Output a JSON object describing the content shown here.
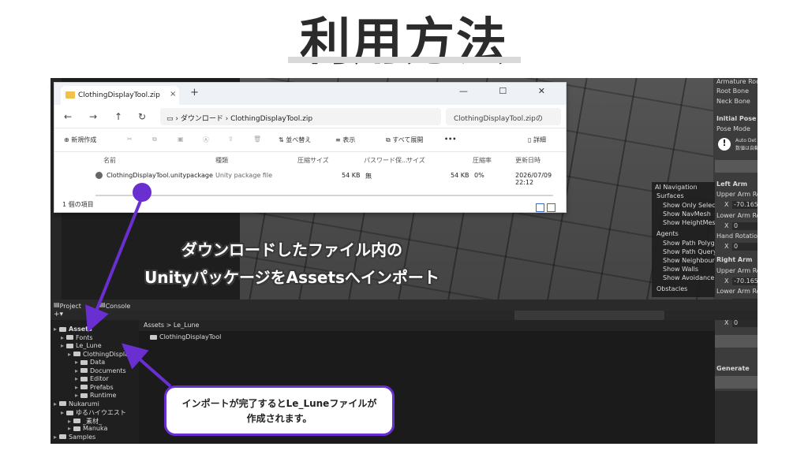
{
  "title": "利用方法",
  "explorer": {
    "tab_title": "ClothingDisplayTool.zip",
    "tab_close": "×",
    "new_tab": "+",
    "window_controls": "— ☐ ✕",
    "nav_back": "←",
    "nav_forward": "→",
    "nav_up": "↑",
    "nav_refresh": "↻",
    "address_path": "▭  ›  ダウンロード  ›  ClothingDisplayTool.zip",
    "search_placeholder": "ClothingDisplayTool.zipの",
    "toolbar": {
      "new": "⊕ 新規作成",
      "sort": "⇅ 並べ替え",
      "view": "≡ 表示",
      "extract_all": "すべて展開",
      "more": "•••",
      "details": "詳細"
    },
    "columns": [
      "名前",
      "種類",
      "圧縮サイズ",
      "パスワード保...",
      "サイズ",
      "圧縮率",
      "更新日時"
    ],
    "row": {
      "name": "ClothingDisplayTool.unitypackage",
      "type": "Unity package file",
      "compressed_size": "54 KB",
      "password": "無",
      "size": "54 KB",
      "ratio": "0%",
      "modified": "2026/07/09 22:12"
    },
    "status": "1 個の項目"
  },
  "unity": {
    "tabs": {
      "project": "Project",
      "console": "Console"
    },
    "add_button": "+▾",
    "tree": [
      {
        "label": "Assets",
        "indent": 0
      },
      {
        "label": "Fonts",
        "indent": 1
      },
      {
        "label": "Le_Lune",
        "indent": 1
      },
      {
        "label": "ClothingDisplay",
        "indent": 2
      },
      {
        "label": "Data",
        "indent": 3
      },
      {
        "label": "Documents",
        "indent": 3
      },
      {
        "label": "Editor",
        "indent": 3
      },
      {
        "label": "Prefabs",
        "indent": 3
      },
      {
        "label": "Runtime",
        "indent": 3
      },
      {
        "label": "Nukarumi",
        "indent": 0
      },
      {
        "label": "ゆるハイウエスト",
        "indent": 1
      },
      {
        "label": "_素材_",
        "indent": 2
      },
      {
        "label": "Manuka",
        "indent": 2
      },
      {
        "label": "Samples",
        "indent": 0
      }
    ],
    "breadcrumb": "Assets  >  Le_Lune",
    "content_item": "ClothingDisplayTool",
    "inspector": {
      "armature_root": "Armature Root",
      "root_bone": "Root Bone",
      "neck_bone": "Neck Bone",
      "initial_pose": "Initial Pose",
      "pose_mode": "Pose Mode",
      "auto_detect": "Auto Det",
      "auto_detect_sub": "数値は自動",
      "left_arm": "Left Arm",
      "upper_arm_rot": "Upper Arm Ro",
      "x_label": "X",
      "upper_val": "-70.165",
      "lower_arm_rot": "Lower Arm Ro",
      "lower_val": "0",
      "hand_rotation": "Hand Rotation",
      "hand_val": "0",
      "right_arm": "Right Arm",
      "generate": "Generate"
    },
    "ai_nav": {
      "header": "AI Navigation",
      "surfaces": "Surfaces",
      "items_surfaces": [
        "Show Only Select",
        "Show NavMesh",
        "Show HeightMesh"
      ],
      "agents": "Agents",
      "items_agents": [
        "Show Path Polygo",
        "Show Path Query",
        "Show Neighbours",
        "Show Walls",
        "Show Avoidance"
      ],
      "obstacles": "Obstacles"
    }
  },
  "captions": {
    "main_line1": "ダウンロードしたファイル内の",
    "main_line2": "UnityパッケージをAssetsへインポート",
    "bubble_line1": "インポートが完了するとLe_Luneファイルが",
    "bubble_line2": "作成されます。"
  },
  "colors": {
    "accent": "#6a2fd0",
    "unity_bg": "#1f1f1f",
    "explorer_bg": "#ffffff"
  }
}
